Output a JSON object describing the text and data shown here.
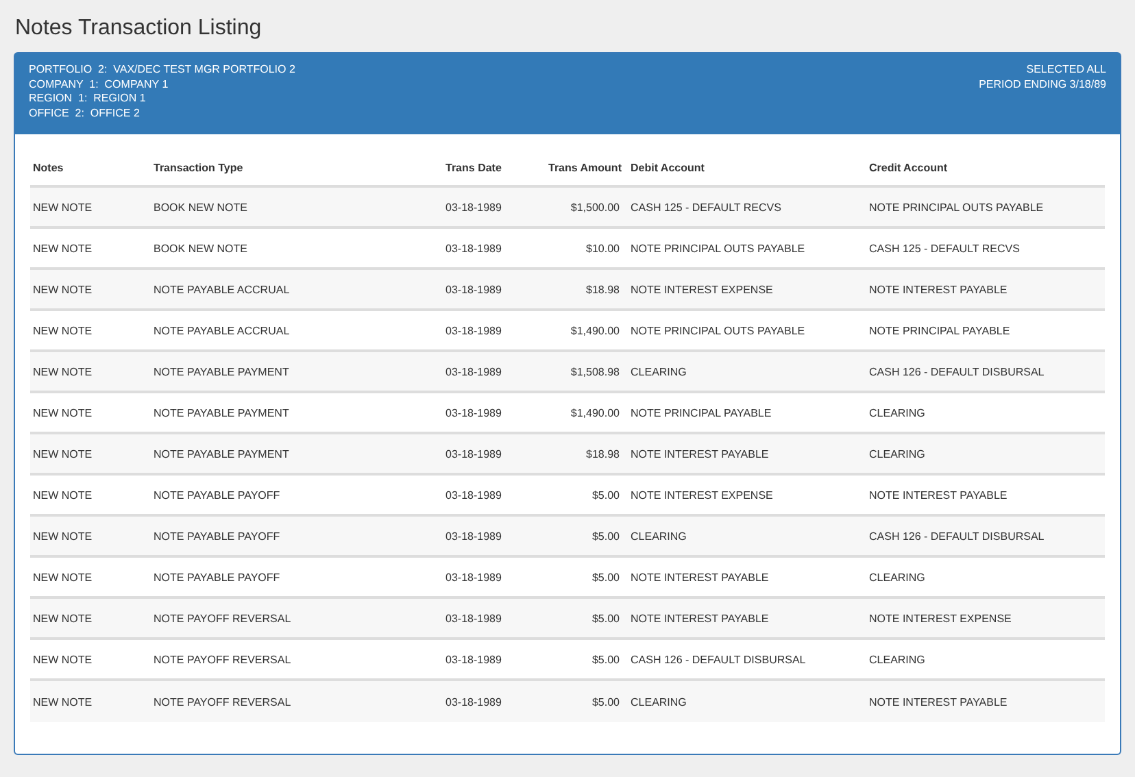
{
  "title": "Notes Transaction Listing",
  "header": {
    "left": [
      "PORTFOLIO  2:  VAX/DEC TEST MGR PORTFOLIO 2",
      "COMPANY  1:  COMPANY 1",
      "REGION  1:  REGION 1",
      "OFFICE  2:  OFFICE 2"
    ],
    "right": [
      "SELECTED ALL",
      "PERIOD ENDING 3/18/89"
    ]
  },
  "table": {
    "columns": [
      "Notes",
      "Transaction Type",
      "Trans Date",
      "Trans Amount",
      "Debit Account",
      "Credit Account"
    ],
    "rows": [
      [
        "NEW NOTE",
        "BOOK NEW NOTE",
        "03-18-1989",
        "$1,500.00",
        "CASH 125 - DEFAULT RECVS",
        "NOTE PRINCIPAL OUTS PAYABLE"
      ],
      [
        "NEW NOTE",
        "BOOK NEW NOTE",
        "03-18-1989",
        "$10.00",
        "NOTE PRINCIPAL OUTS PAYABLE",
        "CASH 125 - DEFAULT RECVS"
      ],
      [
        "NEW NOTE",
        "NOTE PAYABLE ACCRUAL",
        "03-18-1989",
        "$18.98",
        "NOTE INTEREST EXPENSE",
        "NOTE INTEREST PAYABLE"
      ],
      [
        "NEW NOTE",
        "NOTE PAYABLE ACCRUAL",
        "03-18-1989",
        "$1,490.00",
        "NOTE PRINCIPAL OUTS PAYABLE",
        "NOTE PRINCIPAL PAYABLE"
      ],
      [
        "NEW NOTE",
        "NOTE PAYABLE PAYMENT",
        "03-18-1989",
        "$1,508.98",
        "CLEARING",
        "CASH 126 - DEFAULT DISBURSAL"
      ],
      [
        "NEW NOTE",
        "NOTE PAYABLE PAYMENT",
        "03-18-1989",
        "$1,490.00",
        "NOTE PRINCIPAL PAYABLE",
        "CLEARING"
      ],
      [
        "NEW NOTE",
        "NOTE PAYABLE PAYMENT",
        "03-18-1989",
        "$18.98",
        "NOTE INTEREST PAYABLE",
        "CLEARING"
      ],
      [
        "NEW NOTE",
        "NOTE PAYABLE PAYOFF",
        "03-18-1989",
        "$5.00",
        "NOTE INTEREST EXPENSE",
        "NOTE INTEREST PAYABLE"
      ],
      [
        "NEW NOTE",
        "NOTE PAYABLE PAYOFF",
        "03-18-1989",
        "$5.00",
        "CLEARING",
        "CASH 126 - DEFAULT DISBURSAL"
      ],
      [
        "NEW NOTE",
        "NOTE PAYABLE PAYOFF",
        "03-18-1989",
        "$5.00",
        "NOTE INTEREST PAYABLE",
        "CLEARING"
      ],
      [
        "NEW NOTE",
        "NOTE PAYOFF REVERSAL",
        "03-18-1989",
        "$5.00",
        "NOTE INTEREST PAYABLE",
        "NOTE INTEREST EXPENSE"
      ],
      [
        "NEW NOTE",
        "NOTE PAYOFF REVERSAL",
        "03-18-1989",
        "$5.00",
        "CASH 126 - DEFAULT DISBURSAL",
        "CLEARING"
      ],
      [
        "NEW NOTE",
        "NOTE PAYOFF REVERSAL",
        "03-18-1989",
        "$5.00",
        "CLEARING",
        "NOTE INTEREST PAYABLE"
      ]
    ]
  }
}
